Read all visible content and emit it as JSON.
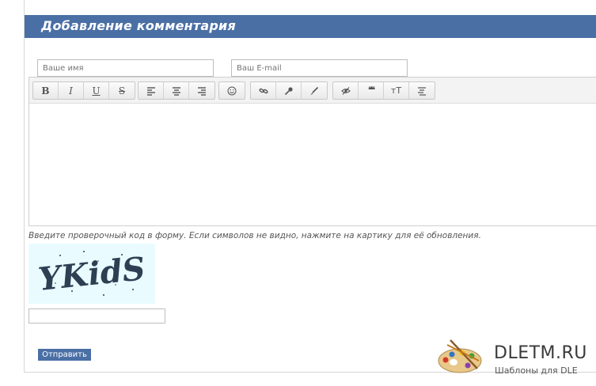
{
  "form": {
    "title": "Добавление комментария",
    "name_placeholder": "Ваше имя",
    "email_placeholder": "Ваш E-mail",
    "captcha_hint": "Введите проверочный код в форму. Если символов не видно, нажмите на картику для её обновления.",
    "captcha_text": "YKidS",
    "submit_label": "Отправить"
  },
  "toolbar": {
    "bold": "B",
    "italic": "I",
    "underline": "U",
    "strike": "S",
    "quote_glyph": "❝❝",
    "font_size": "тТ"
  },
  "brand": {
    "name": "DLETM.RU",
    "tagline": "Шаблоны для DLE"
  },
  "colors": {
    "accent": "#4a6fa5",
    "captcha_bg": "#e9fbff"
  }
}
